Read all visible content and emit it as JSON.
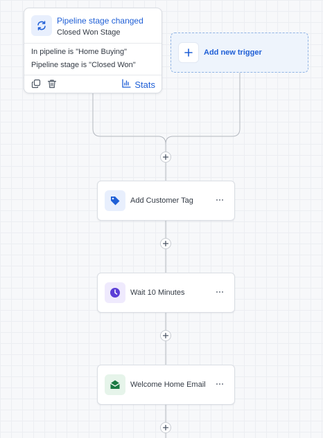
{
  "trigger": {
    "title": "Pipeline stage changed",
    "subtitle": "Closed Won Stage",
    "conditions": [
      "In pipeline is \"Home Buying\"",
      "Pipeline stage is \"Closed Won\""
    ],
    "stats_label": "Stats",
    "icon": "refresh-icon",
    "footer_icons": [
      "copy-icon",
      "trash-icon"
    ]
  },
  "add_trigger": {
    "label": "Add new trigger",
    "icon": "plus-icon"
  },
  "actions": [
    {
      "label": "Add Customer Tag",
      "icon": "tag-icon",
      "icon_color": "#1f5fd6",
      "icon_bg": "#e8effd"
    },
    {
      "label": "Wait 10 Minutes",
      "icon": "clock-icon",
      "icon_color": "#5b3fd6",
      "icon_bg": "#efeafd"
    },
    {
      "label": "Welcome Home Email",
      "icon": "email-icon",
      "icon_color": "#1b7a43",
      "icon_bg": "#e6f4ea"
    }
  ],
  "colors": {
    "accent": "#1f5fd6",
    "connector": "#b3b8bf"
  }
}
